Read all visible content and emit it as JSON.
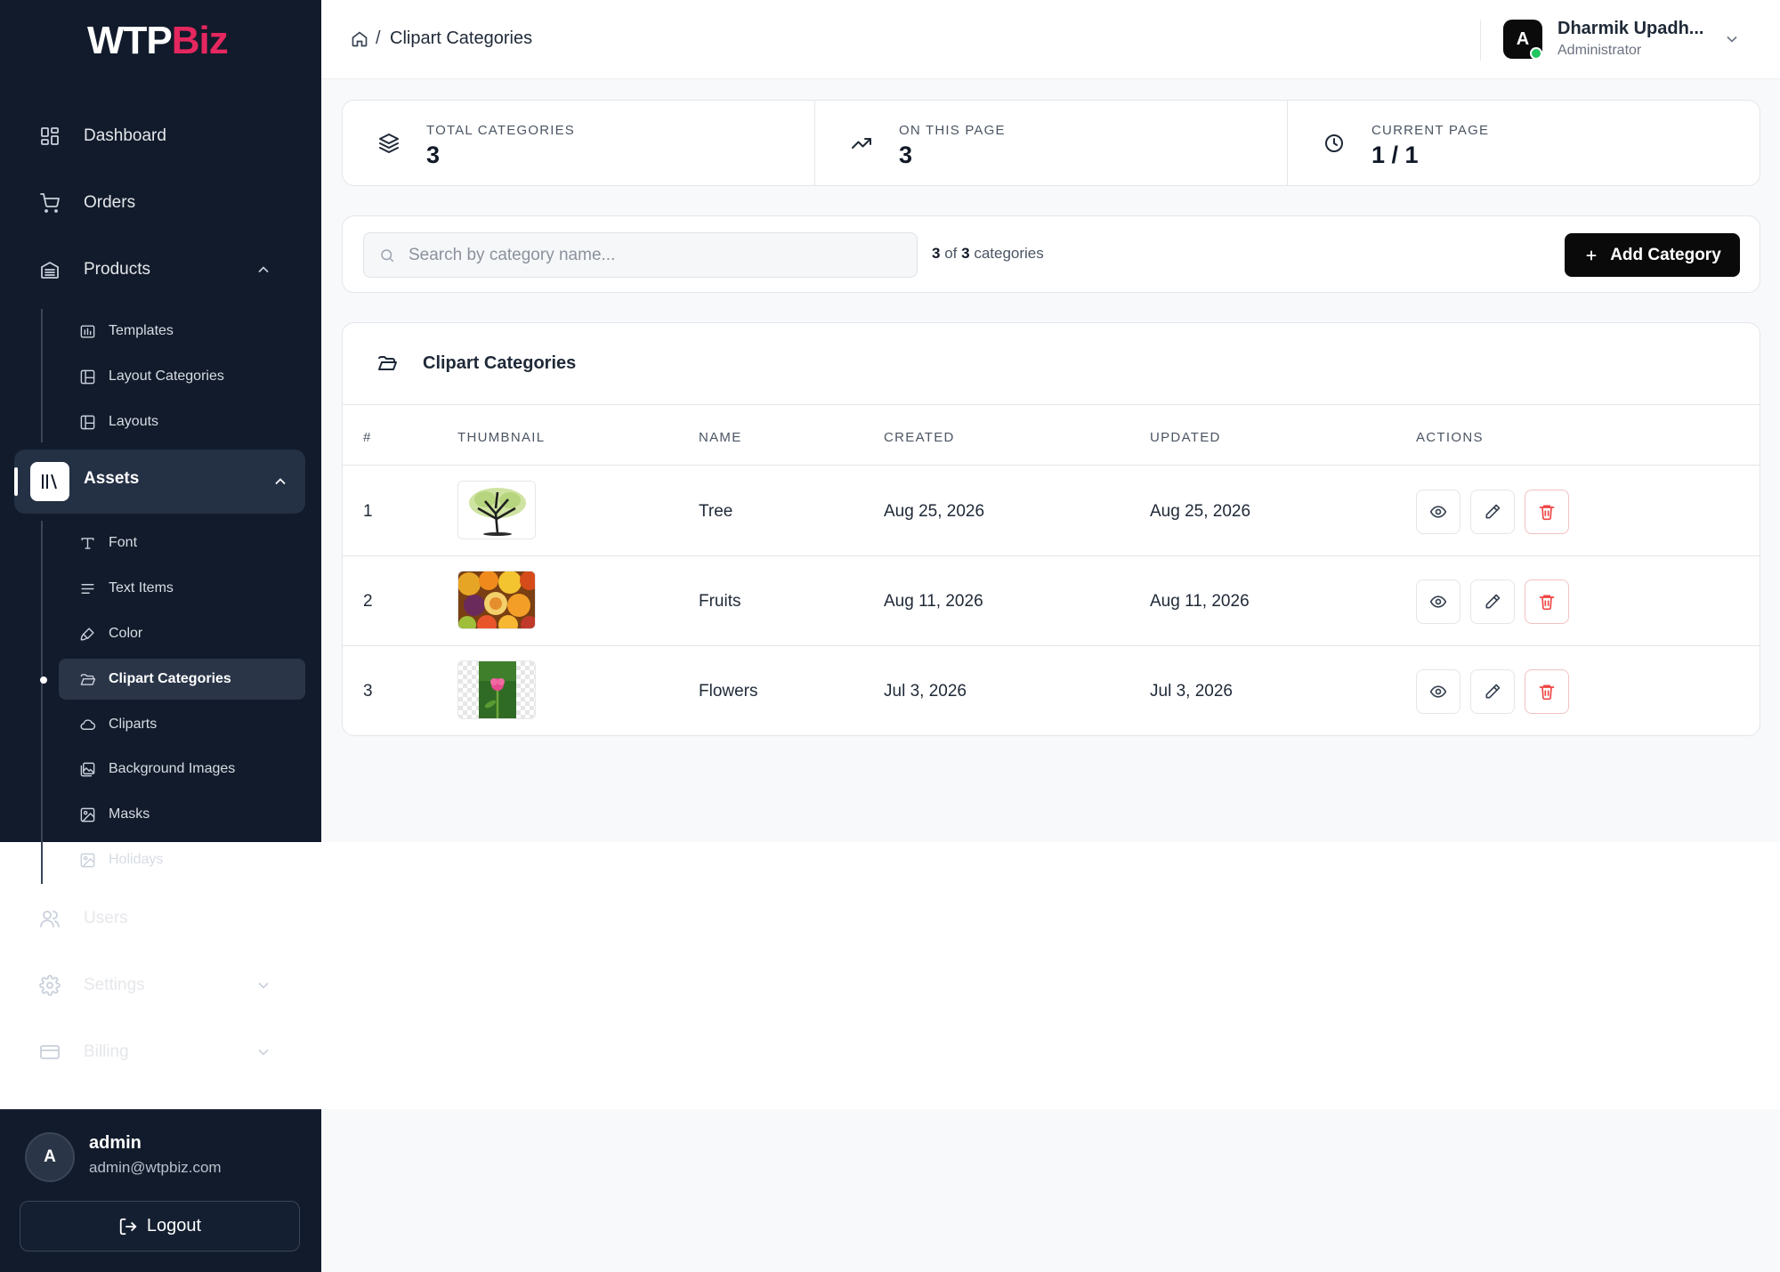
{
  "brand": {
    "part1": "WTP",
    "part2": "Biz",
    "accent_color": "#e5275f"
  },
  "sidebar": {
    "items": [
      {
        "label": "Dashboard",
        "icon": "dashboard-icon"
      },
      {
        "label": "Orders",
        "icon": "cart-icon"
      },
      {
        "label": "Products",
        "icon": "products-icon",
        "expanded": true
      },
      {
        "label": "Assets",
        "icon": "library-icon",
        "expanded": true,
        "active": true
      },
      {
        "label": "Users",
        "icon": "users-icon"
      },
      {
        "label": "Settings",
        "icon": "gear-icon",
        "expanded": false
      },
      {
        "label": "Billing",
        "icon": "credit-card-icon",
        "expanded": false
      }
    ],
    "products_sub": [
      {
        "label": "Templates",
        "icon": "template-icon"
      },
      {
        "label": "Layout Categories",
        "icon": "layout-icon"
      },
      {
        "label": "Layouts",
        "icon": "layout-icon"
      }
    ],
    "assets_sub": [
      {
        "label": "Font",
        "icon": "type-icon"
      },
      {
        "label": "Text Items",
        "icon": "text-lines-icon"
      },
      {
        "label": "Color",
        "icon": "paintbrush-icon"
      },
      {
        "label": "Clipart Categories",
        "icon": "folder-open-icon",
        "active": true
      },
      {
        "label": "Cliparts",
        "icon": "cloud-icon"
      },
      {
        "label": "Background Images",
        "icon": "images-icon"
      },
      {
        "label": "Masks",
        "icon": "image-icon"
      },
      {
        "label": "Holidays",
        "icon": "image-icon"
      }
    ],
    "user": {
      "avatar": "A",
      "name": "admin",
      "email": "admin@wtpbiz.com"
    },
    "logout_label": "Logout"
  },
  "breadcrumb": {
    "separator": "/",
    "current": "Clipart Categories"
  },
  "header_user": {
    "avatar": "A",
    "name": "Dharmik Upadh...",
    "role": "Administrator",
    "status_color": "#22c55e"
  },
  "stats": [
    {
      "label": "TOTAL CATEGORIES",
      "value": "3",
      "icon": "layers-icon"
    },
    {
      "label": "ON THIS PAGE",
      "value": "3",
      "icon": "trending-up-icon"
    },
    {
      "label": "CURRENT PAGE",
      "value": "1 / 1",
      "icon": "clock-icon"
    }
  ],
  "toolbar": {
    "search_placeholder": "Search by category name...",
    "search_value": "",
    "count_shown": "3",
    "count_of": "of",
    "count_total": "3",
    "count_suffix": "categories",
    "add_label": "Add Category"
  },
  "table": {
    "title": "Clipart Categories",
    "columns": [
      "#",
      "THUMBNAIL",
      "NAME",
      "CREATED",
      "UPDATED",
      "ACTIONS"
    ],
    "rows": [
      {
        "index": "1",
        "name": "Tree",
        "created": "Aug 25, 2026",
        "updated": "Aug 25, 2026",
        "thumbnail": "tree-image"
      },
      {
        "index": "2",
        "name": "Fruits",
        "created": "Aug 11, 2026",
        "updated": "Aug 11, 2026",
        "thumbnail": "fruits-image"
      },
      {
        "index": "3",
        "name": "Flowers",
        "created": "Jul 3, 2026",
        "updated": "Jul 3, 2026",
        "thumbnail": "flower-image"
      }
    ]
  }
}
